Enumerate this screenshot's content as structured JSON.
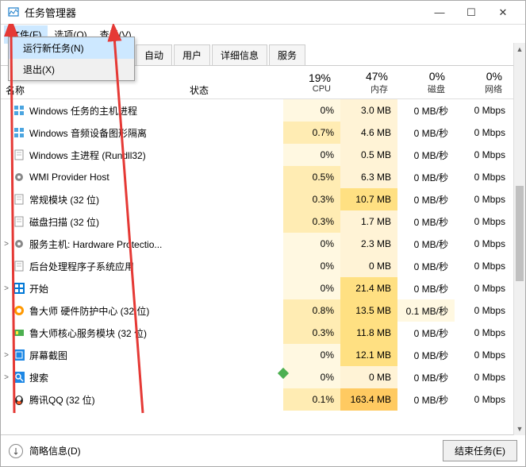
{
  "window": {
    "title": "任务管理器"
  },
  "menubar": {
    "file": "文件(F)",
    "options": "选项(O)",
    "view": "查看(V)"
  },
  "dropdown": {
    "newtask": "运行新任务(N)",
    "exit": "退出(X)"
  },
  "tabs": {
    "t1": "自动",
    "t2": "用户",
    "t3": "详细信息",
    "t4": "服务"
  },
  "headers": {
    "name": "名称",
    "status": "状态",
    "cpu_pct": "19%",
    "cpu_lbl": "CPU",
    "mem_pct": "47%",
    "mem_lbl": "内存",
    "disk_pct": "0%",
    "disk_lbl": "磁盘",
    "net_pct": "0%",
    "net_lbl": "网络"
  },
  "rows": [
    {
      "exp": "",
      "name": "Windows 任务的主机进程",
      "cpu": "0%",
      "mem": "3.0 MB",
      "disk": "0 MB/秒",
      "net": "0 Mbps",
      "cc": 0,
      "mc": 0,
      "dc": 0,
      "icon": "win"
    },
    {
      "exp": "",
      "name": "Windows 音频设备图形隔离",
      "cpu": "0.7%",
      "mem": "4.6 MB",
      "disk": "0 MB/秒",
      "net": "0 Mbps",
      "cc": 1,
      "mc": 0,
      "dc": 0,
      "icon": "win"
    },
    {
      "exp": "",
      "name": "Windows 主进程 (Rundll32)",
      "cpu": "0%",
      "mem": "0.5 MB",
      "disk": "0 MB/秒",
      "net": "0 Mbps",
      "cc": 0,
      "mc": 0,
      "dc": 0,
      "icon": "page"
    },
    {
      "exp": "",
      "name": "WMI Provider Host",
      "cpu": "0.5%",
      "mem": "6.3 MB",
      "disk": "0 MB/秒",
      "net": "0 Mbps",
      "cc": 1,
      "mc": 0,
      "dc": 0,
      "icon": "gear"
    },
    {
      "exp": "",
      "name": "常规模块 (32 位)",
      "cpu": "0.3%",
      "mem": "10.7 MB",
      "disk": "0 MB/秒",
      "net": "0 Mbps",
      "cc": 1,
      "mc": 1,
      "dc": 0,
      "icon": "page"
    },
    {
      "exp": "",
      "name": "磁盘扫描 (32 位)",
      "cpu": "0.3%",
      "mem": "1.7 MB",
      "disk": "0 MB/秒",
      "net": "0 Mbps",
      "cc": 1,
      "mc": 0,
      "dc": 0,
      "icon": "page"
    },
    {
      "exp": ">",
      "name": "服务主机: Hardware Protectio...",
      "cpu": "0%",
      "mem": "2.3 MB",
      "disk": "0 MB/秒",
      "net": "0 Mbps",
      "cc": 0,
      "mc": 0,
      "dc": 0,
      "icon": "gear"
    },
    {
      "exp": "",
      "name": "后台处理程序子系统应用",
      "cpu": "0%",
      "mem": "0 MB",
      "disk": "0 MB/秒",
      "net": "0 Mbps",
      "cc": 0,
      "mc": 0,
      "dc": 0,
      "icon": "page"
    },
    {
      "exp": ">",
      "name": "开始",
      "cpu": "0%",
      "mem": "21.4 MB",
      "disk": "0 MB/秒",
      "net": "0 Mbps",
      "cc": 0,
      "mc": 1,
      "dc": 0,
      "icon": "start"
    },
    {
      "exp": "",
      "name": "鲁大师 硬件防护中心 (32 位)",
      "cpu": "0.8%",
      "mem": "13.5 MB",
      "disk": "0.1 MB/秒",
      "net": "0 Mbps",
      "cc": 1,
      "mc": 1,
      "dc": 1,
      "icon": "ludashi"
    },
    {
      "exp": "",
      "name": "鲁大师核心服务模块 (32 位)",
      "cpu": "0.3%",
      "mem": "11.8 MB",
      "disk": "0 MB/秒",
      "net": "0 Mbps",
      "cc": 1,
      "mc": 1,
      "dc": 0,
      "icon": "ludashi2"
    },
    {
      "exp": ">",
      "name": "屏幕截图",
      "cpu": "0%",
      "mem": "12.1 MB",
      "disk": "0 MB/秒",
      "net": "0 Mbps",
      "cc": 0,
      "mc": 1,
      "dc": 0,
      "icon": "blue"
    },
    {
      "exp": ">",
      "name": "搜索",
      "cpu": "0%",
      "mem": "0 MB",
      "disk": "0 MB/秒",
      "net": "0 Mbps",
      "cc": 0,
      "mc": 0,
      "dc": 0,
      "icon": "search"
    },
    {
      "exp": "",
      "name": "腾讯QQ (32 位)",
      "cpu": "0.1%",
      "mem": "163.4 MB",
      "disk": "0 MB/秒",
      "net": "0 Mbps",
      "cc": 1,
      "mc": 2,
      "dc": 0,
      "icon": "qq"
    }
  ],
  "footer": {
    "brief": "简略信息(D)",
    "endtask": "结束任务(E)"
  }
}
